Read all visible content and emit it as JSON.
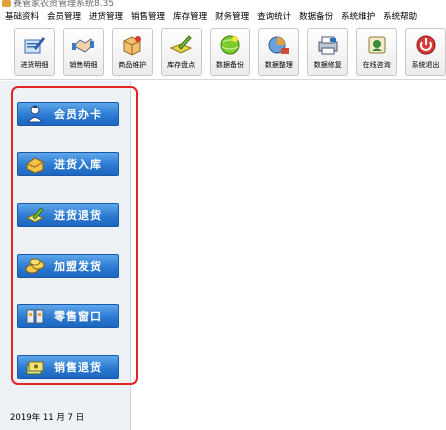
{
  "window": {
    "title": "赛管家农资管理系统8.35"
  },
  "menu": {
    "items": [
      "基础资料",
      "会员管理",
      "进货管理",
      "销售管理",
      "库存管理",
      "财务管理",
      "查询统计",
      "数据备份",
      "系统维护",
      "系统帮助"
    ]
  },
  "toolbar": {
    "items": [
      {
        "label": "进货明细",
        "icon": "ledger-pencil-icon"
      },
      {
        "label": "销售明细",
        "icon": "handshake-icon"
      },
      {
        "label": "商品维护",
        "icon": "product-box-icon"
      },
      {
        "label": "库存盘点",
        "icon": "inventory-pencil-icon"
      },
      {
        "label": "数据备份",
        "icon": "green-globe-icon"
      },
      {
        "label": "数据整理",
        "icon": "data-sort-icon"
      },
      {
        "label": "数据修复",
        "icon": "printer-repair-icon"
      },
      {
        "label": "在线咨询",
        "icon": "online-chat-icon"
      },
      {
        "label": "系统退出",
        "icon": "power-exit-icon"
      }
    ]
  },
  "sidebar": {
    "items": [
      {
        "label": "会员办卡",
        "icon": "member-card-icon"
      },
      {
        "label": "进货入库",
        "icon": "stock-in-icon"
      },
      {
        "label": "进货退货",
        "icon": "stock-return-icon"
      },
      {
        "label": "加盟发货",
        "icon": "coins-icon"
      },
      {
        "label": "零售窗口",
        "icon": "retail-window-icon"
      },
      {
        "label": "销售退货",
        "icon": "sales-return-icon"
      }
    ]
  },
  "status": {
    "date": "2019年  11 月 7  日"
  },
  "colors": {
    "sidebar_button": "#2b7ad2",
    "highlight": "#e32424"
  }
}
